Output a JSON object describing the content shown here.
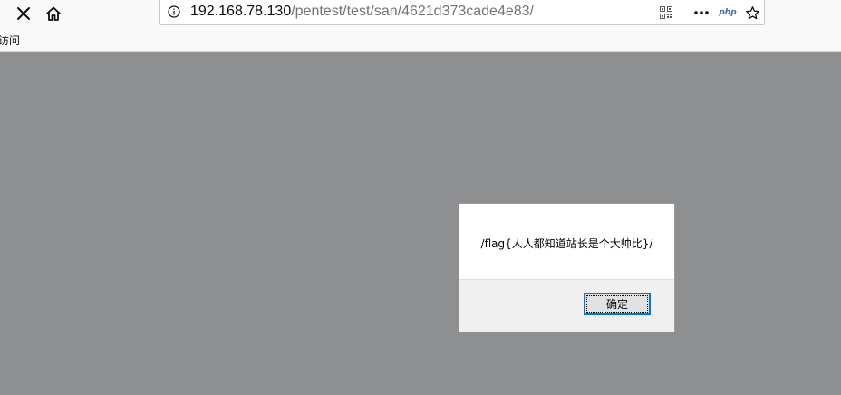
{
  "browser": {
    "url": {
      "host": "192.168.78.130",
      "path": "/pentest/test/san/4621d373cade4e83/"
    },
    "icons": {
      "stop": "close-icon",
      "home": "home-icon",
      "info": "info-icon",
      "qr": "qr-code-icon",
      "more": "more-icon",
      "php": "php",
      "bookmark": "star-icon"
    },
    "bookmarks": {
      "item": "访问"
    }
  },
  "dialog": {
    "message": "/flag{人人都知道站长是个大帅比}/",
    "ok_label": "确定"
  },
  "colors": {
    "overlay": "#8e8f90",
    "accent": "#0078d7",
    "php_icon": "#3d6ab0"
  }
}
